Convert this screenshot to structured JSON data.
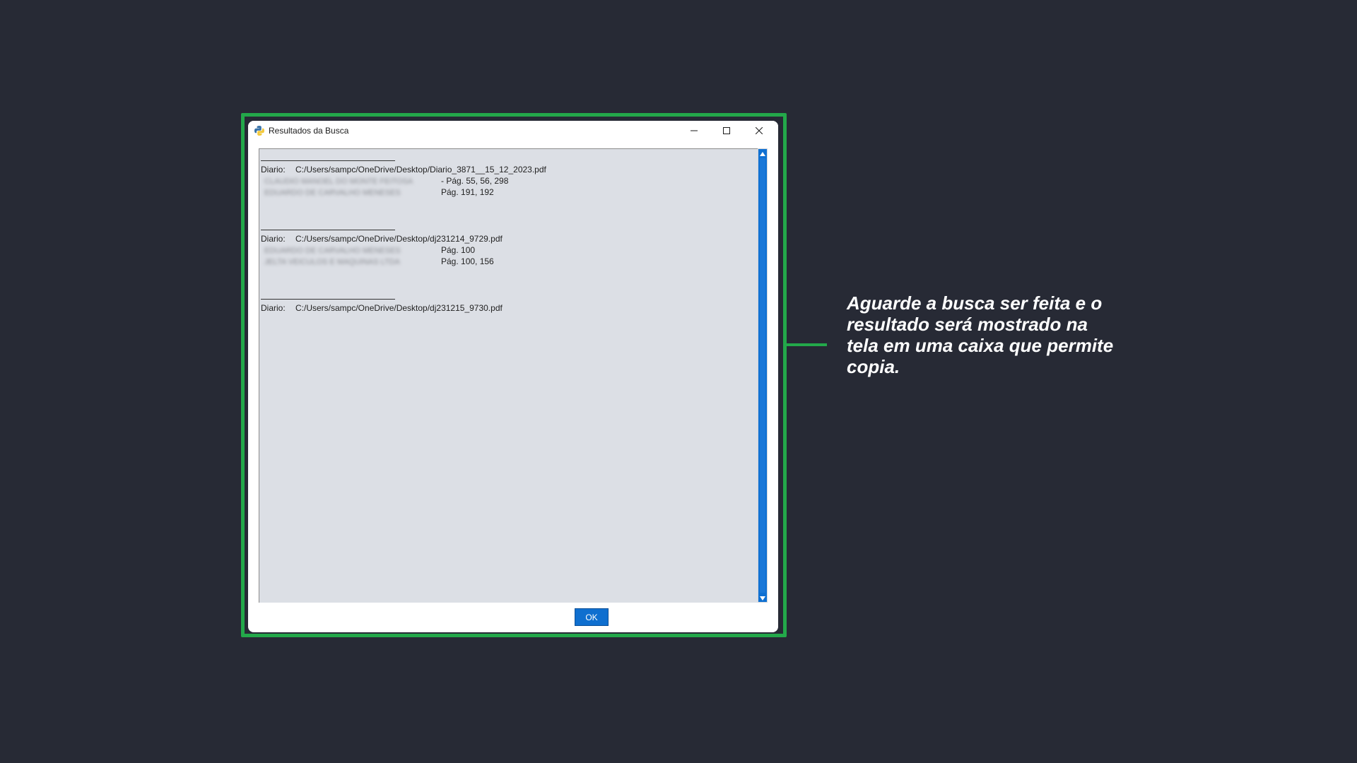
{
  "window": {
    "title": "Resultados da Busca",
    "ok_label": "OK"
  },
  "results": [
    {
      "label": "Diario:",
      "path": "C:/Users/sampc/OneDrive/Desktop/Diario_3871__15_12_2023.pdf",
      "matches": [
        {
          "name": "CLAUDIO MANOEL DO MONTE FEITOSA",
          "pages": "-   Pág. 55, 56, 298"
        },
        {
          "name": "EDUARDO DE CARVALHO MENESES",
          "pages": "Pág. 191, 192"
        }
      ]
    },
    {
      "label": "Diario:",
      "path": "C:/Users/sampc/OneDrive/Desktop/dj231214_9729.pdf",
      "matches": [
        {
          "name": "EDUARDO DE CARVALHO MENESES",
          "pages": "Pág. 100"
        },
        {
          "name": "JELTA VEICULOS E MAQUINAS LTDA",
          "pages": "Pág. 100, 156"
        }
      ]
    },
    {
      "label": "Diario:",
      "path": "C:/Users/sampc/OneDrive/Desktop/dj231215_9730.pdf",
      "matches": []
    }
  ],
  "caption": "Aguarde a busca ser feita e o resultado será mostrado na tela em uma caixa que permite copia.",
  "colors": {
    "background": "#272a35",
    "highlight": "#23a84a",
    "textbox": "#dcdfe5",
    "accent": "#0f6fcf"
  },
  "icons": {
    "app": "python-icon",
    "minimize": "minimize-icon",
    "maximize": "maximize-icon",
    "close": "close-icon"
  }
}
